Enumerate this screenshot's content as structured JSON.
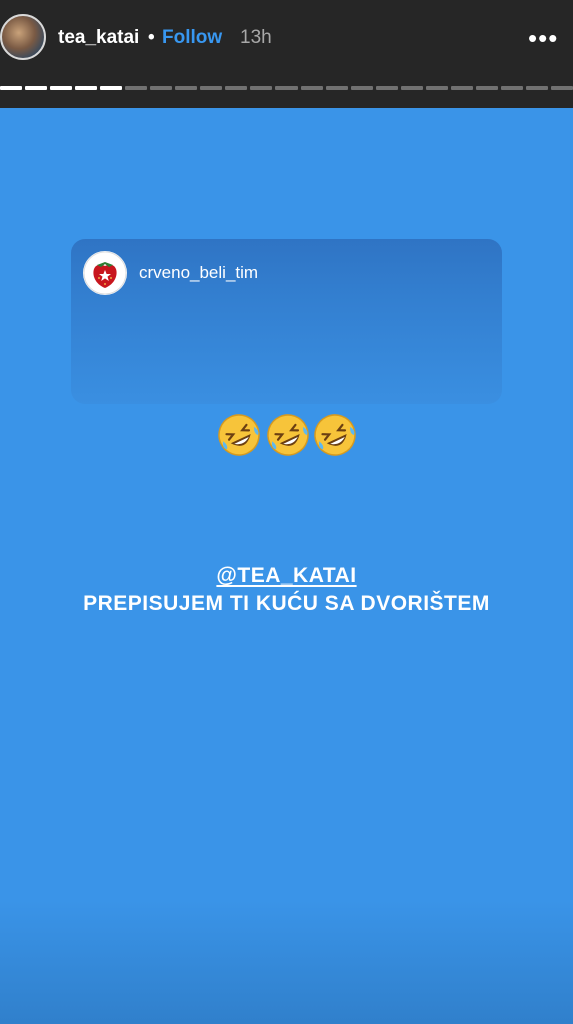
{
  "header": {
    "username": "tea_katai",
    "separator": "•",
    "follow_label": "Follow",
    "time_ago": "13h",
    "more_icon": "more-horizontal-icon",
    "more_glyph": "•••"
  },
  "story_progress": {
    "segments_total": 23,
    "segments_viewed": 5
  },
  "shared_post": {
    "account": "crveno_beli_tim",
    "avatar_icon": "strawberry-logo-icon"
  },
  "emojis": [
    "rolling-on-the-floor-laughing",
    "rolling-on-the-floor-laughing",
    "rolling-on-the-floor-laughing"
  ],
  "caption": {
    "mention": "@TEA_KATAI",
    "text": "PREPISUJEM TI KUĆU SA DVORIŠTEM"
  },
  "colors": {
    "background": "#3a94e8",
    "topbar": "#262626",
    "follow": "#3897f0"
  }
}
